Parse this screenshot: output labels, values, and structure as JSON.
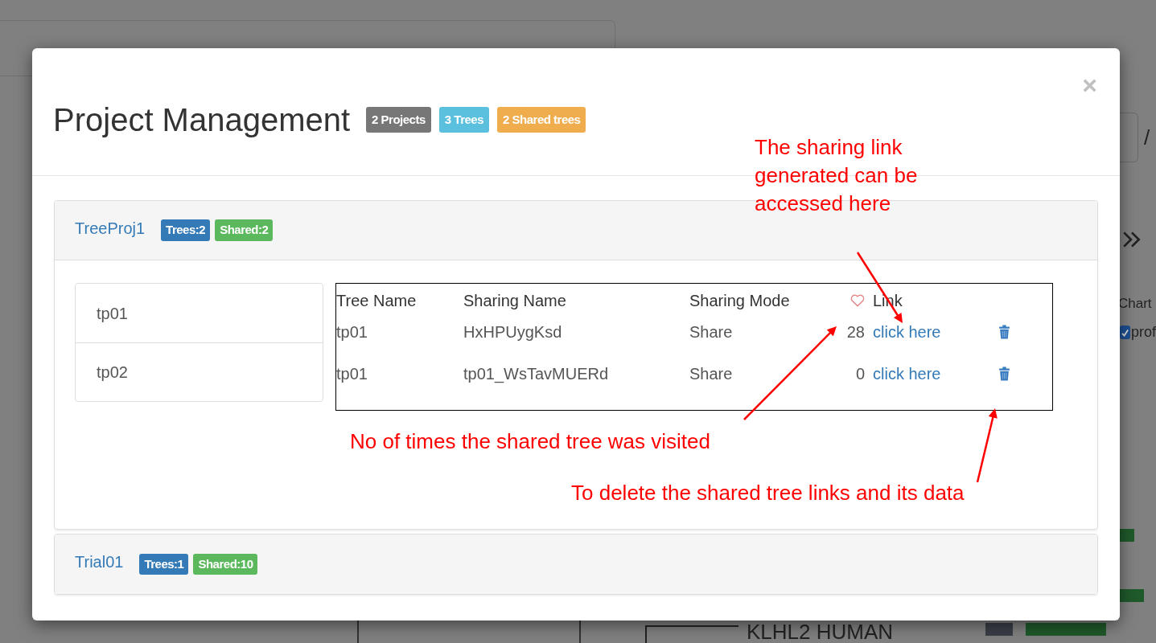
{
  "background": {
    "slash": "/",
    "panel_title": "Chart",
    "checkbox": {
      "label": "prof",
      "checked": true
    },
    "tree_label": "KLHL2 HUMAN"
  },
  "modal": {
    "title": "Project Management",
    "close": "×",
    "badges": [
      {
        "label": "2 Projects",
        "color": "#777777"
      },
      {
        "label": "3 Trees",
        "color": "#5bc0de"
      },
      {
        "label": "2 Shared trees",
        "color": "#f0ad4e"
      }
    ]
  },
  "projects": [
    {
      "name": "TreeProj1",
      "expanded": true,
      "badges": [
        {
          "label": "Trees:2",
          "color": "#337ab7"
        },
        {
          "label": "Shared:2",
          "color": "#5cb85c"
        }
      ],
      "trees": [
        "tp01",
        "tp02"
      ],
      "table": {
        "columns": {
          "tree_name": "Tree Name",
          "sharing_name": "Sharing Name",
          "sharing_mode": "Sharing Mode",
          "link": "Link"
        },
        "rows": [
          {
            "tree_name": "tp01",
            "sharing_name": "HxHPUygKsd",
            "sharing_mode": "Share",
            "visits": "28",
            "link": "click here"
          },
          {
            "tree_name": "tp01",
            "sharing_name": "tp01_WsTavMUERd",
            "sharing_mode": "Share",
            "visits": "0",
            "link": "click here"
          }
        ]
      }
    },
    {
      "name": "Trial01",
      "expanded": false,
      "badges": [
        {
          "label": "Trees:1",
          "color": "#337ab7"
        },
        {
          "label": "Shared:10",
          "color": "#5cb85c"
        }
      ]
    }
  ],
  "annotations": [
    "The sharing link generated can be accessed here",
    "No of times the shared tree was visited",
    "To delete the shared tree links and its data"
  ]
}
